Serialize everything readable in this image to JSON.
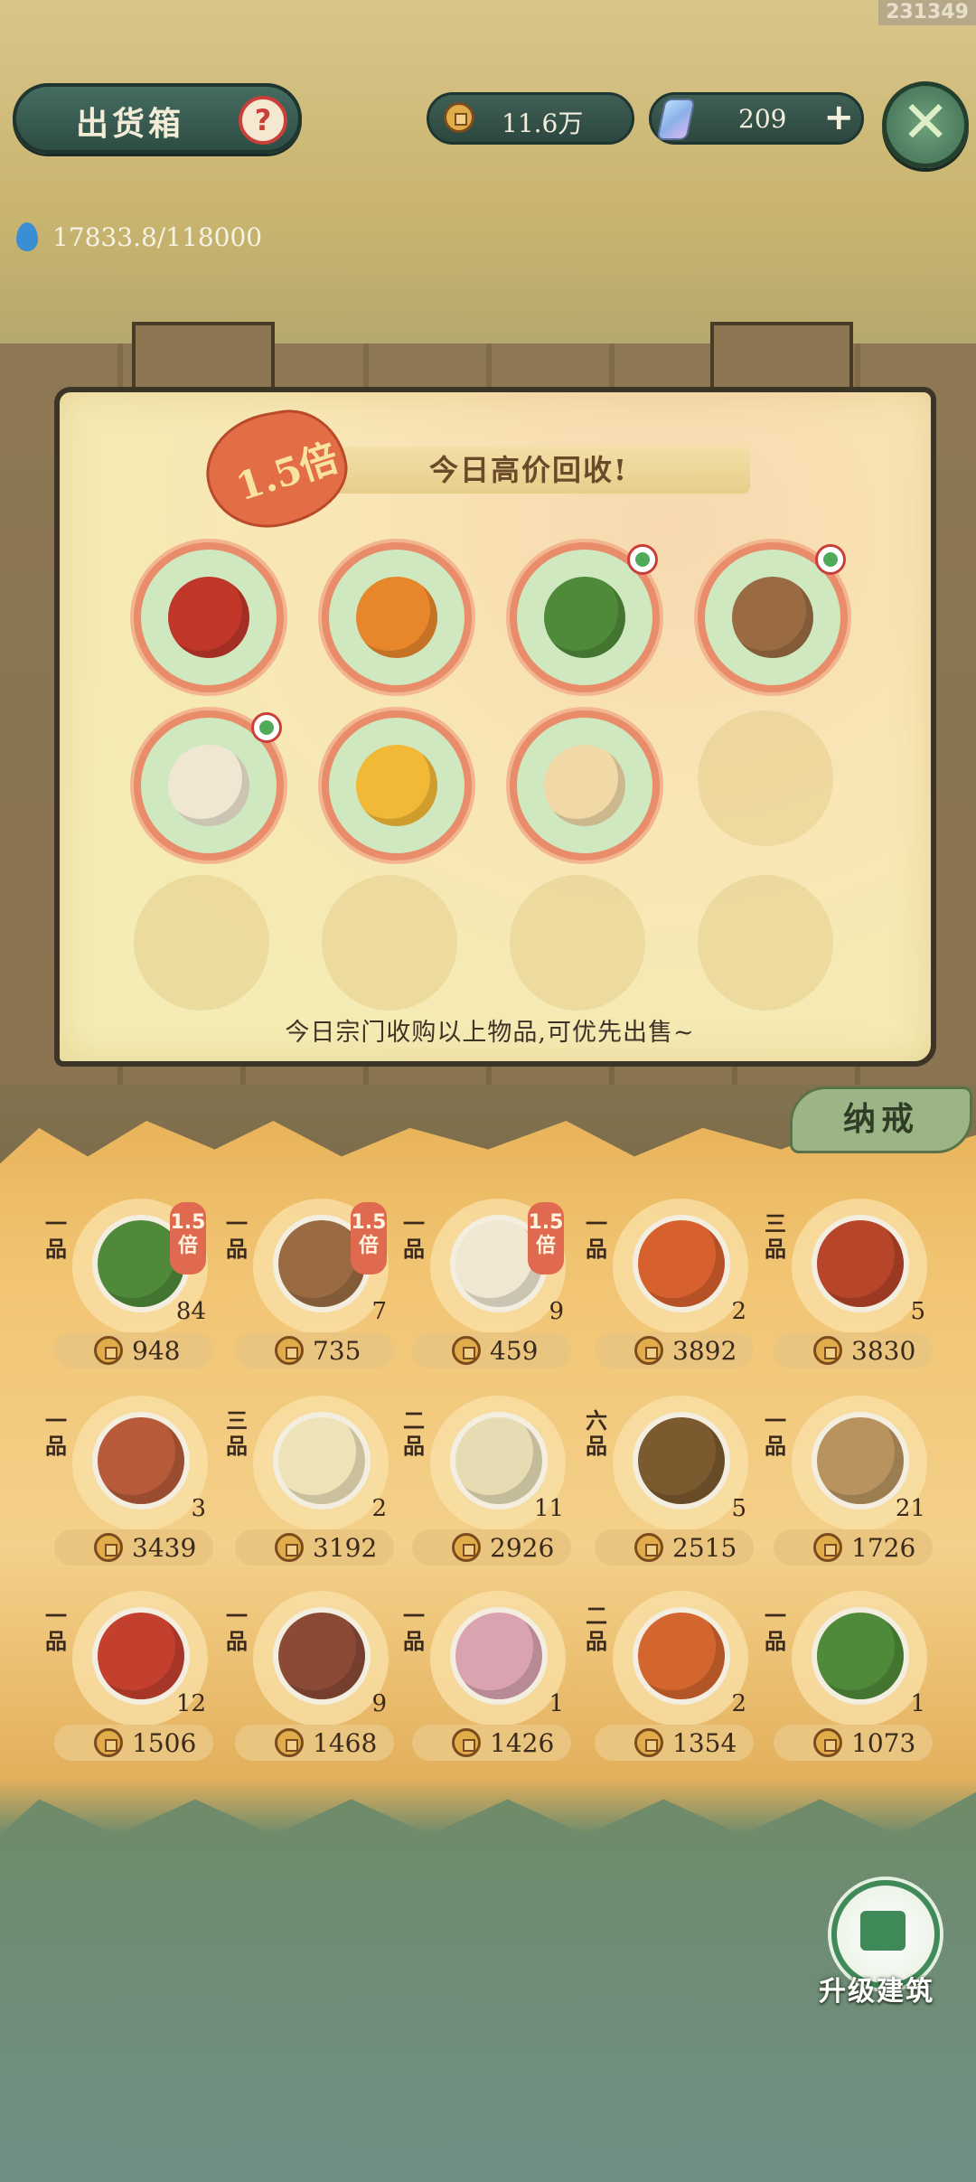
{
  "corner_id": "231349",
  "header": {
    "title": "出货箱",
    "help_icon": "question-icon",
    "coins": "11.6万",
    "gems": "209",
    "plus": "+",
    "close": "✕"
  },
  "water": {
    "value": "17833.8/118000"
  },
  "notice": {
    "bonus_label": "1.5倍",
    "banner": "今日高价回收!",
    "footer": "今日宗门收购以上物品,可优先出售~",
    "wanted_items": [
      {
        "name": "chili",
        "color": "#c0372a",
        "badge": false
      },
      {
        "name": "oranges",
        "color": "#e8862c",
        "badge": false
      },
      {
        "name": "watermelon",
        "color": "#4f8a3a",
        "badge": true
      },
      {
        "name": "clay-pot",
        "color": "#9a6b43",
        "badge": true
      },
      {
        "name": "rice-bowl",
        "color": "#efe7d2",
        "badge": true
      },
      {
        "name": "fried-egg",
        "color": "#f2b936",
        "badge": false
      },
      {
        "name": "noodle-plate",
        "color": "#f0d9a6",
        "badge": false
      }
    ]
  },
  "storage": {
    "tab_label": "纳戒",
    "items": [
      {
        "grade": "一品",
        "mult": "1.5倍",
        "count": "84",
        "price": "948",
        "color": "#4f8a3a"
      },
      {
        "grade": "一品",
        "mult": "1.5倍",
        "count": "7",
        "price": "735",
        "color": "#9a6b43"
      },
      {
        "grade": "一品",
        "mult": "1.5倍",
        "count": "9",
        "price": "459",
        "color": "#efe7d2"
      },
      {
        "grade": "一品",
        "mult": "",
        "count": "2",
        "price": "3892",
        "color": "#d6602e"
      },
      {
        "grade": "三品",
        "mult": "",
        "count": "5",
        "price": "3830",
        "color": "#b6452a"
      },
      {
        "grade": "一品",
        "mult": "",
        "count": "3",
        "price": "3439",
        "color": "#b65a3a"
      },
      {
        "grade": "三品",
        "mult": "",
        "count": "2",
        "price": "3192",
        "color": "#eee2b9"
      },
      {
        "grade": "二品",
        "mult": "",
        "count": "11",
        "price": "2926",
        "color": "#e6dcb4"
      },
      {
        "grade": "六品",
        "mult": "",
        "count": "5",
        "price": "2515",
        "color": "#7a5a2e"
      },
      {
        "grade": "一品",
        "mult": "",
        "count": "21",
        "price": "1726",
        "color": "#b89360"
      },
      {
        "grade": "一品",
        "mult": "",
        "count": "12",
        "price": "1506",
        "color": "#c4402e"
      },
      {
        "grade": "一品",
        "mult": "",
        "count": "9",
        "price": "1468",
        "color": "#8a4a36"
      },
      {
        "grade": "一品",
        "mult": "",
        "count": "1",
        "price": "1426",
        "color": "#d9a3b0"
      },
      {
        "grade": "二品",
        "mult": "",
        "count": "2",
        "price": "1354",
        "color": "#d2662e"
      },
      {
        "grade": "一品",
        "mult": "",
        "count": "1",
        "price": "1073",
        "color": "#4f8a3a"
      }
    ]
  },
  "upgrade": {
    "label": "升级建筑"
  }
}
